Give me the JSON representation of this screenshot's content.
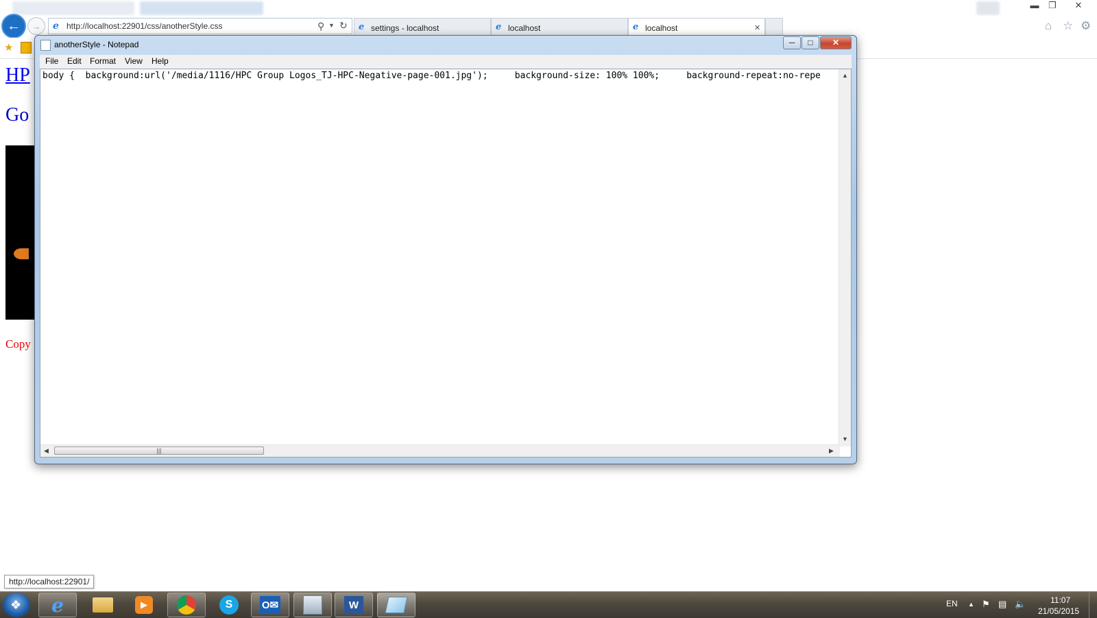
{
  "browser": {
    "address_url": "http://localhost:22901/css/anotherStyle.css",
    "tabs": [
      {
        "label": "settings - localhost"
      },
      {
        "label": "localhost"
      },
      {
        "label": "localhost"
      }
    ],
    "tab_close_glyph": "✕"
  },
  "page": {
    "heading_fragment": "HP",
    "line2_fragment": "Go",
    "footer_fragment": "Copy"
  },
  "notepad": {
    "title": "anotherStyle - Notepad",
    "menu": [
      "File",
      "Edit",
      "Format",
      "View",
      "Help"
    ],
    "content": "body {  background:url('/media/1116/HPC Group Logos_TJ-HPC-Negative-page-001.jpg');     background-size: 100% 100%;     background-repeat:no-repe",
    "close_glyph": "✕"
  },
  "status_url": "http://localhost:22901/",
  "taskbar": {
    "apps": [
      "start-orb",
      "internet-explorer",
      "file-explorer",
      "media-player",
      "chrome",
      "skype",
      "outlook",
      "server-manager",
      "word",
      "notepad"
    ],
    "language": "EN",
    "time": "11:07",
    "date": "21/05/2015"
  },
  "colors": {
    "ie_blue": "#1f6fc5",
    "page_link": "#0000ee",
    "page_copyright": "#ee0000",
    "notepad_frame": "#a9c7e6",
    "close_red": "#c8452d"
  }
}
